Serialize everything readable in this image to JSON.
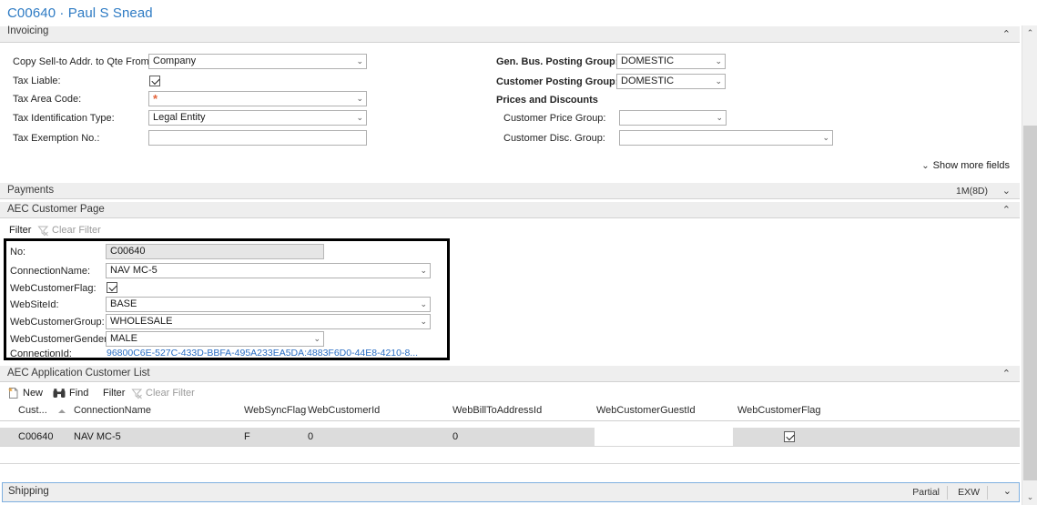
{
  "page": {
    "title": "C00640 · Paul S Snead"
  },
  "sections": {
    "invoicing": {
      "label": "Invoicing",
      "collapse_chevron": "⌃"
    },
    "payments": {
      "label": "Payments",
      "right_value": "1M(8D)",
      "collapse_chevron": "⌄"
    },
    "aec_customer_page": {
      "label": "AEC Customer Page",
      "collapse_chevron": "⌃"
    },
    "aec_application_customer_list": {
      "label": "AEC Application Customer List",
      "collapse_chevron": "⌃"
    },
    "shipping": {
      "label": "Shipping",
      "value_1": "Partial",
      "value_2": "EXW",
      "collapse_chevron": "⌄"
    }
  },
  "invoicing": {
    "left_fields": [
      {
        "label": "Copy Sell-to Addr. to Qte From:",
        "value": "Company",
        "type": "dropdown"
      },
      {
        "label": "Tax Liable:",
        "value": "",
        "type": "checkbox",
        "checked": true
      },
      {
        "label": "Tax Area Code:",
        "value": "*",
        "type": "dropdown-star"
      },
      {
        "label": "Tax Identification Type:",
        "value": "Legal Entity",
        "type": "dropdown"
      },
      {
        "label": "Tax Exemption No.:",
        "value": "",
        "type": "text"
      }
    ],
    "right_fields": [
      {
        "label": "Gen. Bus. Posting Group:",
        "value": "DOMESTIC",
        "type": "dropdown"
      },
      {
        "label": "Customer Posting Group:",
        "value": "DOMESTIC",
        "type": "dropdown"
      }
    ],
    "subgroup_title": "Prices and Discounts",
    "subgroup_fields": [
      {
        "label": "Customer Price Group:",
        "value": "",
        "type": "dropdown"
      },
      {
        "label": "Customer Disc. Group:",
        "value": "",
        "type": "dropdown"
      }
    ],
    "show_more_fields": "Show more fields",
    "show_more_chevron": "⌄"
  },
  "aec_customer_page": {
    "toolbar": {
      "filter": "Filter",
      "clear_filter": "Clear Filter",
      "clear_filter_icon": "funnel-clear-icon"
    },
    "fields": [
      {
        "label": "No:",
        "value": "C00640",
        "type": "readonly"
      },
      {
        "label": "ConnectionName:",
        "value": "NAV MC-5",
        "type": "dropdown"
      },
      {
        "label": "WebCustomerFlag:",
        "value": "",
        "type": "checkbox",
        "checked": true
      },
      {
        "label": "WebSiteId:",
        "value": "BASE",
        "type": "dropdown"
      },
      {
        "label": "WebCustomerGroup:",
        "value": "WHOLESALE",
        "type": "dropdown"
      },
      {
        "label": "WebCustomerGender:",
        "value": "MALE",
        "type": "dropdown"
      },
      {
        "label": "ConnectionId:",
        "value": "96800C6E-527C-433D-BBFA-495A233EA5DA:4883F6D0-44E8-4210-8...",
        "type": "link"
      }
    ]
  },
  "aec_application_customer_list": {
    "toolbar": {
      "new": "New",
      "new_icon": "new-page-icon",
      "find": "Find",
      "find_icon": "binoculars-icon",
      "filter": "Filter",
      "clear_filter": "Clear Filter",
      "clear_filter_icon": "funnel-clear-icon"
    },
    "columns": [
      "Cust...",
      "ConnectionName",
      "WebSyncFlag",
      "WebCustomerId",
      "WebBillToAddressId",
      "WebCustomerGuestId",
      "WebCustomerFlag"
    ],
    "sorted_column_index": 0,
    "rows": [
      {
        "cust": "C00640",
        "connection_name": "NAV MC-5",
        "web_sync_flag": "F",
        "web_customer_id": "0",
        "web_bill_to_address_id": "0",
        "web_customer_guest_id": "",
        "web_customer_flag_checked": true
      }
    ]
  },
  "colors": {
    "title_blue": "#2e7bc4",
    "link_blue": "#2a6ec4",
    "header_gray": "#eeeeee",
    "row_gray": "#dcdcdc",
    "highlight_box": "#000000",
    "required_star": "#e4633a",
    "focus_border": "#7fb0e0"
  },
  "scrollbars": {
    "up_arrow": "⌃",
    "down_arrow": "⌄"
  }
}
